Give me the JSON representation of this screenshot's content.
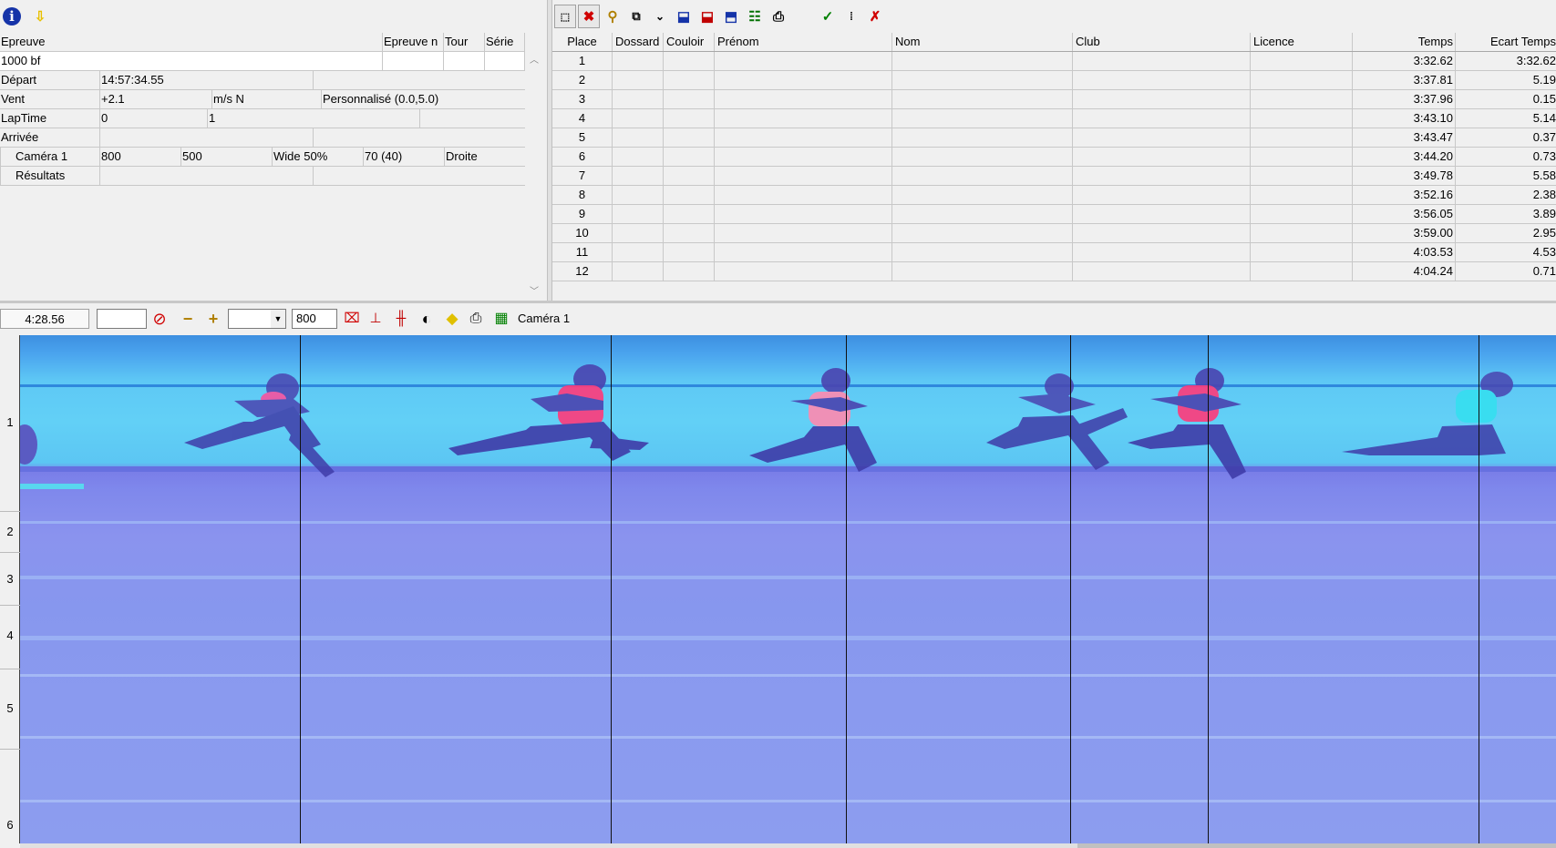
{
  "left_panel": {
    "headers": [
      "Epreuve",
      "Epreuve n",
      "Tour",
      "Série"
    ],
    "event_name": "1000 bf",
    "rows": [
      {
        "label": "Départ",
        "cells": [
          "14:57:34.55",
          "",
          ""
        ]
      },
      {
        "label": "Vent",
        "cells": [
          "+2.1",
          "m/s N",
          "Personnalisé (0.0,5.0)"
        ]
      },
      {
        "label": "LapTime",
        "cells": [
          "0",
          "1",
          ""
        ]
      },
      {
        "label": "Arrivée",
        "cells": [
          "",
          "",
          ""
        ]
      },
      {
        "label": "Caméra 1",
        "cells": [
          "800",
          "500",
          "Wide 50%",
          "70  (40)",
          "Droite"
        ]
      },
      {
        "label": "Résultats",
        "cells": [
          "",
          ""
        ]
      }
    ]
  },
  "results": {
    "headers": [
      "Place",
      "Dossard",
      "Couloir",
      "Prénom",
      "Nom",
      "Club",
      "Licence",
      "Temps",
      "Ecart Temps"
    ],
    "rows": [
      {
        "place": "1",
        "temps": "3:32.62",
        "ecart": "3:32.62"
      },
      {
        "place": "2",
        "temps": "3:37.81",
        "ecart": "5.19"
      },
      {
        "place": "3",
        "temps": "3:37.96",
        "ecart": "0.15"
      },
      {
        "place": "4",
        "temps": "3:43.10",
        "ecart": "5.14"
      },
      {
        "place": "5",
        "temps": "3:43.47",
        "ecart": "0.37"
      },
      {
        "place": "6",
        "temps": "3:44.20",
        "ecart": "0.73"
      },
      {
        "place": "7",
        "temps": "3:49.78",
        "ecart": "5.58"
      },
      {
        "place": "8",
        "temps": "3:52.16",
        "ecart": "2.38"
      },
      {
        "place": "9",
        "temps": "3:56.05",
        "ecart": "3.89"
      },
      {
        "place": "10",
        "temps": "3:59.00",
        "ecart": "2.95"
      },
      {
        "place": "11",
        "temps": "4:03.53",
        "ecart": "4.53"
      },
      {
        "place": "12",
        "temps": "4:04.24",
        "ecart": "0.71"
      }
    ]
  },
  "image_toolbar": {
    "time": "4:28.56",
    "input_value": "",
    "zoom_select": "",
    "width_value": "800",
    "camera_label": "Caméra 1"
  },
  "lanes": [
    "1",
    "2",
    "3",
    "4",
    "5",
    "6"
  ],
  "colors": {
    "accent": "#1a3fb0",
    "photo_top": "#62d0f6",
    "photo_bottom": "#8c9def",
    "runner_top": "#ff3a7a"
  }
}
